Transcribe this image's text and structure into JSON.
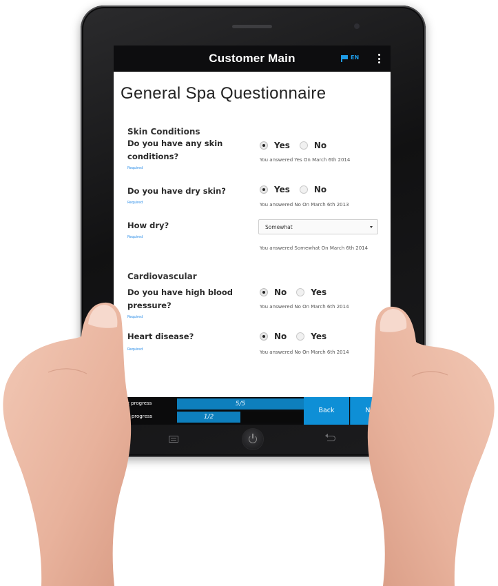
{
  "app_bar": {
    "title": "Customer Main",
    "language": "EN",
    "flag_icon": "flag-icon",
    "menu_icon": "kebab-menu-icon"
  },
  "page": {
    "title": "General Spa Questionnaire"
  },
  "sections": [
    {
      "title": "Skin Conditions",
      "questions": [
        {
          "text": "Do you have any skin conditions?",
          "required": "Required",
          "options": [
            "Yes",
            "No"
          ],
          "selected": "Yes",
          "answer_note": "You answered Yes On March 6th 2014"
        },
        {
          "text": "Do you have dry skin?",
          "required": "Required",
          "options": [
            "Yes",
            "No"
          ],
          "selected": "Yes",
          "answer_note": "You answered No On March 6th 2013"
        },
        {
          "text": "How dry?",
          "required": "Required",
          "select_value": "Somewhat",
          "answer_note": "You answered Somewhat On March 6th 2014"
        }
      ]
    },
    {
      "title": "Cardiovascular",
      "questions": [
        {
          "text": "Do you have high blood pressure?",
          "required": "Required",
          "options": [
            "No",
            "Yes"
          ],
          "selected": "No",
          "answer_note": "You answered No On March 6th 2014"
        },
        {
          "text": "Heart disease?",
          "required": "Required",
          "options": [
            "No",
            "Yes"
          ],
          "selected": "No",
          "answer_note": "You answered No On March 6th 2014"
        }
      ]
    }
  ],
  "footer": {
    "page_progress_label": "Page progress",
    "page_progress_text": "5/5",
    "page_progress_fraction": 1.0,
    "form_progress_label": "Form progress",
    "form_progress_text": "1/2",
    "form_progress_fraction": 0.5,
    "back_label": "Back",
    "next_label": "Next"
  },
  "colors": {
    "accent": "#0e8fd6",
    "progress_fill": "#0e7fbd",
    "app_bar": "#0d0d0f",
    "language": "#1e9be6"
  }
}
